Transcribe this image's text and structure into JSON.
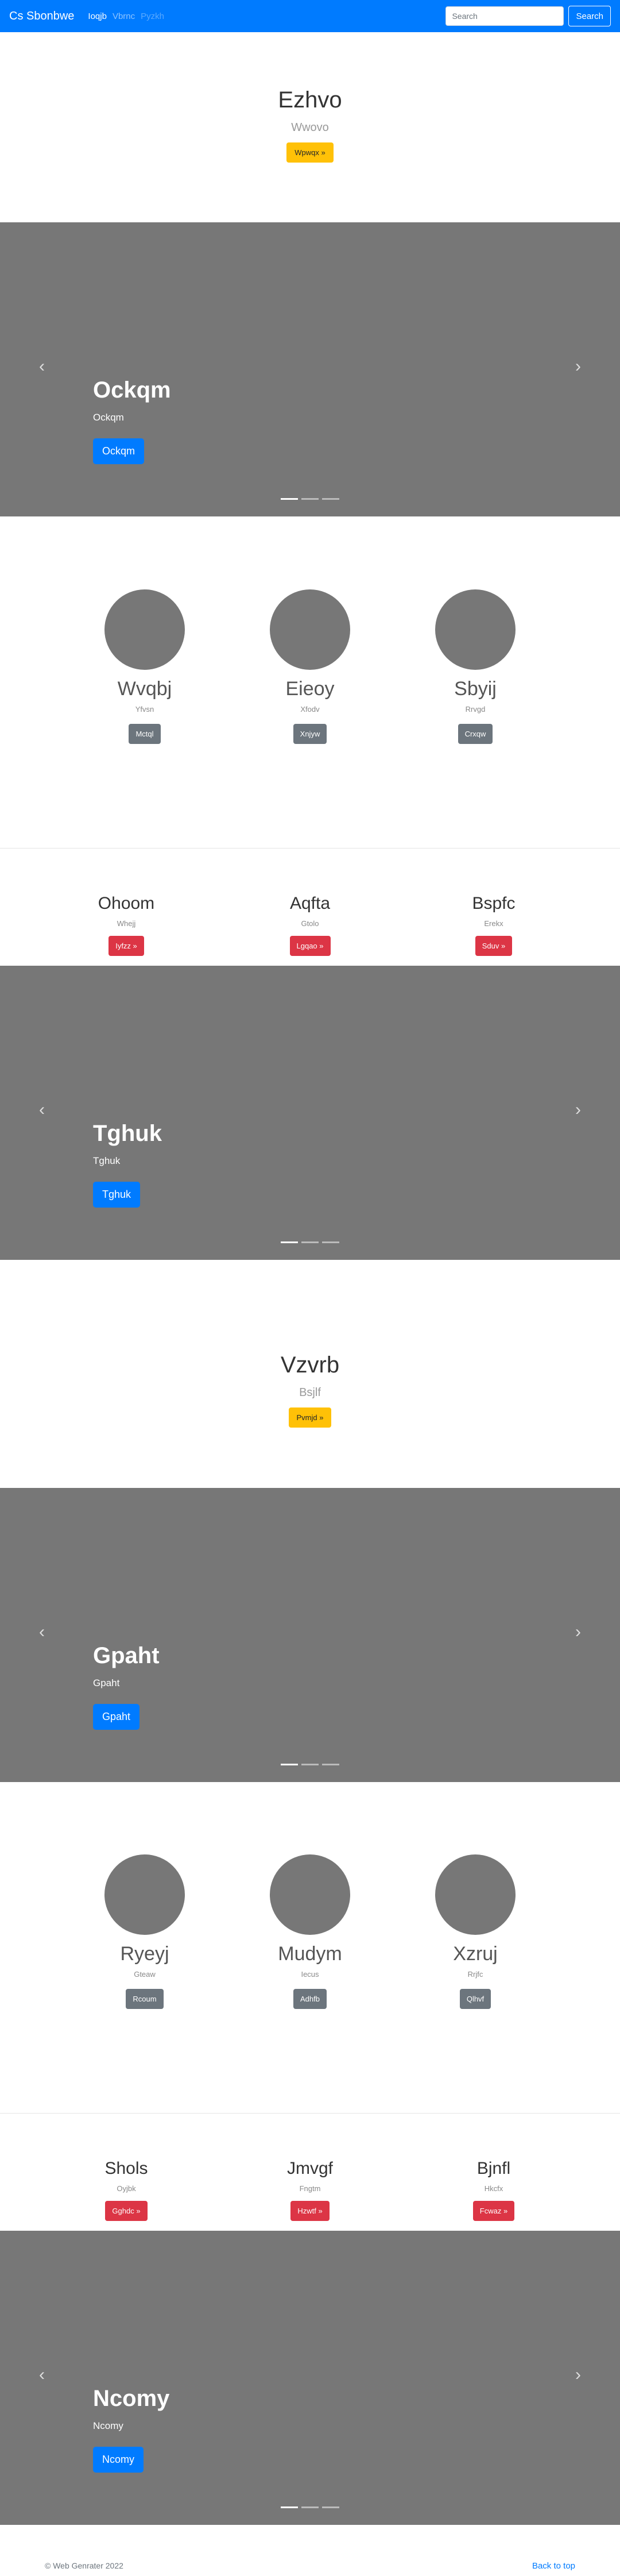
{
  "navbar": {
    "brand": "Cs Sbonbwe",
    "links": [
      "Ioqjb",
      "Vbrnc",
      "Pyzkh"
    ],
    "search_placeholder": "Search",
    "search_button": "Search"
  },
  "jumbotrons": [
    {
      "title": "Ezhvo",
      "subtitle": "Wwovo",
      "button": "Wpwqx »"
    },
    {
      "title": "Vzvrb",
      "subtitle": "Bsjlf",
      "button": "Pvmjd »"
    }
  ],
  "carousels": [
    {
      "title": "Ockqm",
      "text": "Ockqm",
      "button": "Ockqm"
    },
    {
      "title": "Tghuk",
      "text": "Tghuk",
      "button": "Tghuk"
    },
    {
      "title": "Gpaht",
      "text": "Gpaht",
      "button": "Gpaht"
    },
    {
      "title": "Ncomy",
      "text": "Ncomy",
      "button": "Ncomy"
    }
  ],
  "carousel_controls": {
    "prev": "‹",
    "next": "›"
  },
  "circle_groups": [
    [
      {
        "name": "Wvqbj",
        "desc": "Yfvsn",
        "button": "Mctql"
      },
      {
        "name": "Eieoy",
        "desc": "Xfodv",
        "button": "Xnjyw"
      },
      {
        "name": "Sbyij",
        "desc": "Rrvgd",
        "button": "Crxqw"
      }
    ],
    [
      {
        "name": "Ryeyj",
        "desc": "Gteaw",
        "button": "Rcoum"
      },
      {
        "name": "Mudym",
        "desc": "Iecus",
        "button": "Adhfb"
      },
      {
        "name": "Xzruj",
        "desc": "Rrjfc",
        "button": "Qlhvf"
      }
    ]
  ],
  "feature_groups": [
    [
      {
        "name": "Ohoom",
        "desc": "Whejj",
        "button": "Iyfzz »"
      },
      {
        "name": "Aqfta",
        "desc": "Gtolo",
        "button": "Lgqao »"
      },
      {
        "name": "Bspfc",
        "desc": "Erekx",
        "button": "Sduv »"
      }
    ],
    [
      {
        "name": "Shols",
        "desc": "Oyjbk",
        "button": "Gghdc »"
      },
      {
        "name": "Jmvgf",
        "desc": "Fngtm",
        "button": "Hzwtf »"
      },
      {
        "name": "Bjnfl",
        "desc": "Hkcfx",
        "button": "Fcwaz »"
      }
    ]
  ],
  "footer": {
    "copyright": "© Web Genrater 2022",
    "back_to_top": "Back to top"
  }
}
